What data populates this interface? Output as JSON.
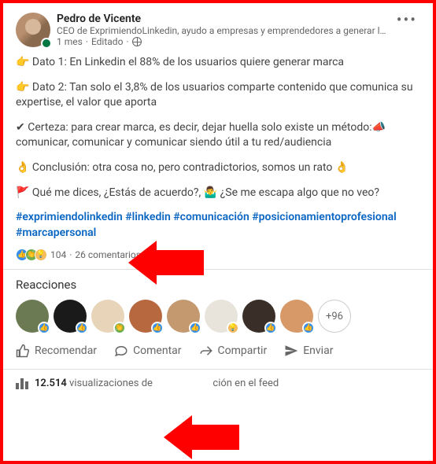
{
  "author": {
    "name": "Pedro de Vicente",
    "subtitle": "CEO de ExprimiendoLinkedin, ayudo a empresas y emprendedores a generar leads, …",
    "meta_time": "1 mes",
    "meta_edited": "Editado"
  },
  "post": {
    "p1": "👉 Dato 1: En Linkedin el 88% de los usuarios quiere generar marca",
    "p2": "👉 Dato 2: Tan solo el 3,8% de los usuarios comparte contenido que comunica su expertise, el valor que aporta",
    "p3": "✔ Certeza: para crear marca, es decir, dejar huella solo existe un método:📣 comunicar, comunicar y comunicar siendo útil a tu red/audiencia",
    "p4": "👌 Conclusión: otra cosa no, pero contradictorios, somos un rato 👌",
    "p5": "🚩 Qué me dices, ¿Estás de acuerdo?, 🤷‍♂️ ¿Se me escapa algo que no veo?"
  },
  "hashtags": {
    "h1": "#exprimiendolinkedin",
    "h2": "#linkedin",
    "h3": "#comunicación",
    "h4": "#posicionamientoprofesional",
    "h5": "#marcapersonal"
  },
  "counts": {
    "reactions": "104",
    "sep": " · ",
    "comments": "26 comentarios"
  },
  "section": {
    "reacciones": "Reacciones",
    "more_reactors": "+96"
  },
  "actions": {
    "recomendar": "Recomendar",
    "comentar": "Comentar",
    "compartir": "Compartir",
    "enviar": "Enviar"
  },
  "views": {
    "count": "12.514",
    "label_a": " visualizaciones de",
    "label_b": "ción en el feed"
  },
  "reactor_colors": [
    "#6b7a52",
    "#1a1a1a",
    "#e8d4b8",
    "#b8683f",
    "#c49970",
    "#e8e4dc",
    "#3a2f28",
    "#d89968"
  ]
}
